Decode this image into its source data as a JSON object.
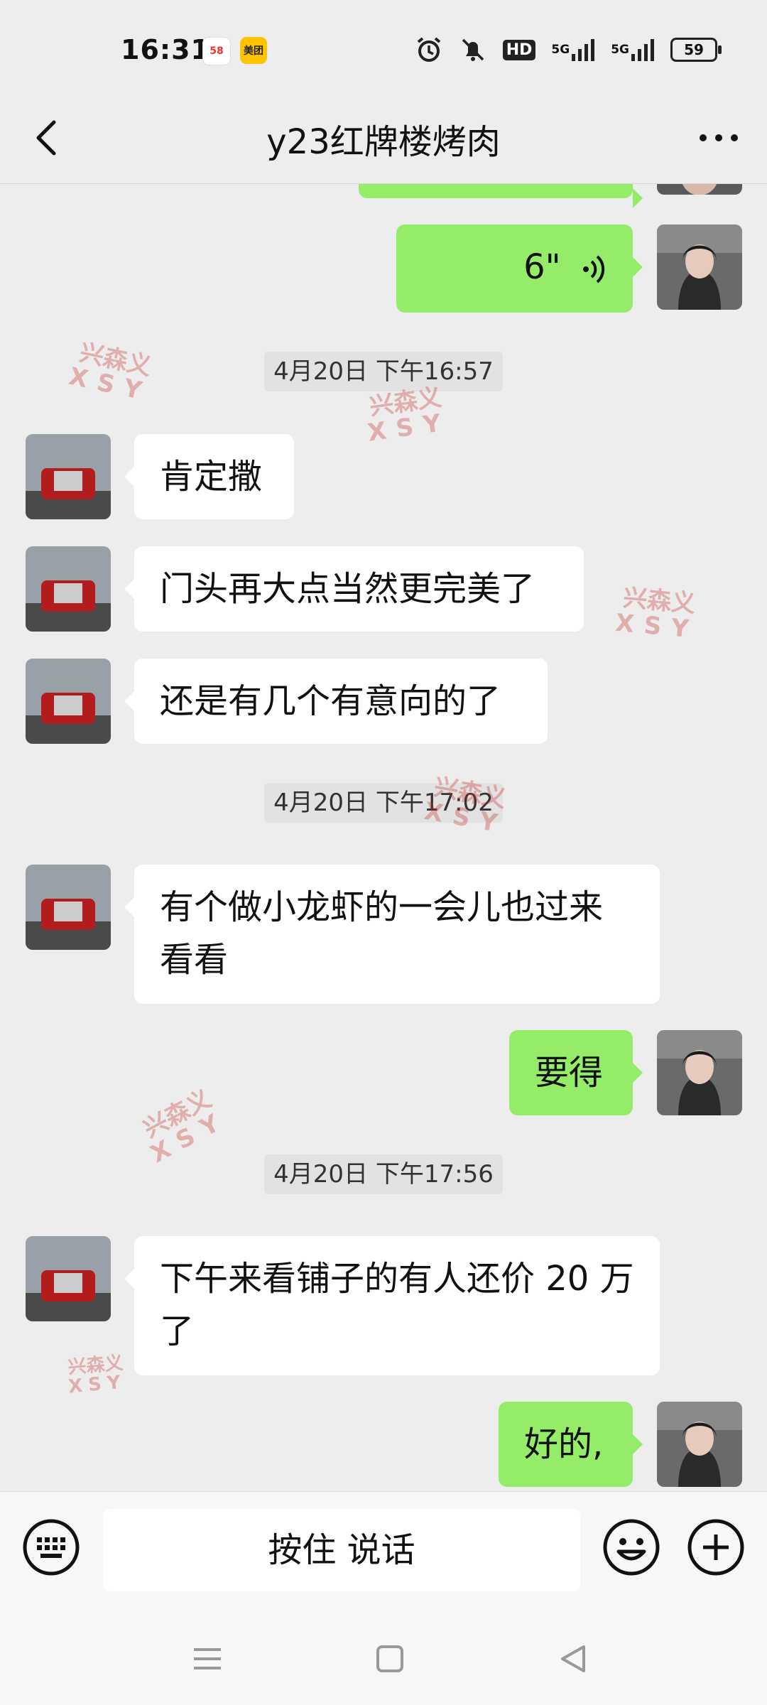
{
  "status_bar": {
    "time": "16:31",
    "app_icons": [
      "58",
      "美团"
    ],
    "network_1": "5G",
    "network_2": "5G",
    "hd_label": "HD",
    "battery": "59"
  },
  "header": {
    "title": "y23红牌楼烤肉",
    "back_icon": "chevron-left-icon",
    "more_icon": "more-dots-icon"
  },
  "messages": [
    {
      "type": "voice",
      "side": "out",
      "duration": "6\""
    },
    {
      "type": "timestamp",
      "text": "4月20日 下午16:57"
    },
    {
      "type": "text",
      "side": "in",
      "text": "肯定撒"
    },
    {
      "type": "text",
      "side": "in",
      "text": "门头再大点当然更完美了"
    },
    {
      "type": "text",
      "side": "in",
      "text": "还是有几个有意向的了"
    },
    {
      "type": "timestamp",
      "text": "4月20日 下午17:02"
    },
    {
      "type": "text",
      "side": "in",
      "text": "有个做小龙虾的一会儿也过来看看"
    },
    {
      "type": "text",
      "side": "out",
      "text": "要得"
    },
    {
      "type": "timestamp",
      "text": "4月20日 下午17:56"
    },
    {
      "type": "text",
      "side": "in",
      "text": "下午来看铺子的有人还价 20 万了"
    },
    {
      "type": "text",
      "side": "out",
      "text": "好的,"
    }
  ],
  "watermark": {
    "line1": "兴森义",
    "line2": "XSY"
  },
  "input_bar": {
    "hold_to_talk": "按住 说话",
    "keyboard_icon": "keyboard-icon",
    "emoji_icon": "emoji-icon",
    "plus_icon": "plus-icon"
  },
  "colors": {
    "outgoing_bubble": "#95ec69",
    "incoming_bubble": "#ffffff",
    "background": "#ededed"
  }
}
